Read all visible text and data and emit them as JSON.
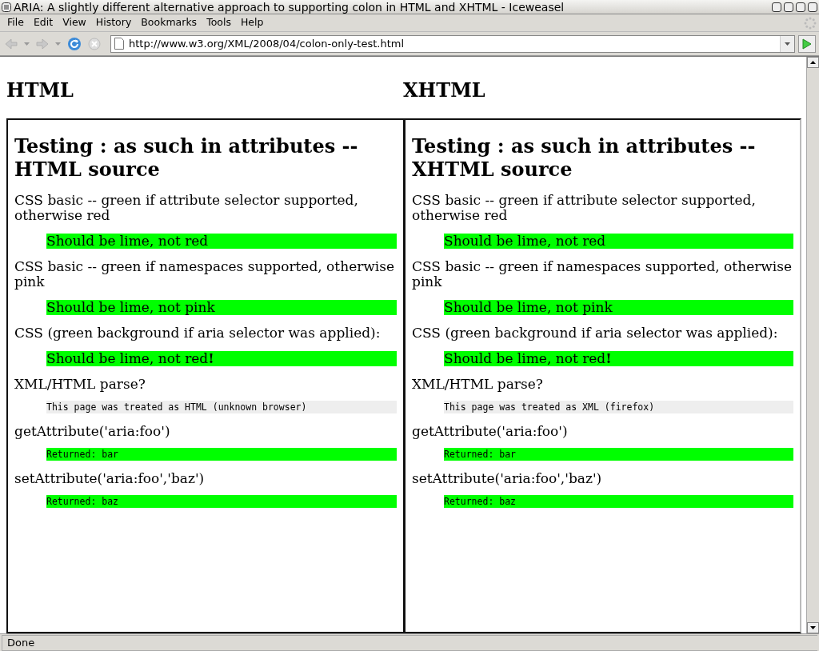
{
  "window": {
    "title": "ARIA: A slightly different alternative approach to supporting colon in HTML and XHTML - Iceweasel"
  },
  "menu": [
    {
      "label": "File"
    },
    {
      "label": "Edit"
    },
    {
      "label": "View"
    },
    {
      "label": "History"
    },
    {
      "label": "Bookmarks"
    },
    {
      "label": "Tools"
    },
    {
      "label": "Help"
    }
  ],
  "toolbar": {
    "back_disabled": true,
    "forward_disabled": true,
    "stop_disabled": true,
    "url": "http://www.w3.org/XML/2008/04/colon-only-test.html"
  },
  "columns": [
    {
      "heading": "HTML",
      "frame": {
        "title": "Testing : as such in attributes -- HTML source",
        "tests": [
          {
            "label": "CSS basic -- green if attribute selector supported, otherwise red",
            "result": {
              "kind": "prose",
              "text": "Should be lime, not red",
              "color": "#00ff00"
            }
          },
          {
            "label": "CSS basic -- green if namespaces supported, otherwise pink",
            "result": {
              "kind": "prose",
              "text": "Should be lime, not pink",
              "color": "#00ff00"
            }
          },
          {
            "label": "CSS (green background if aria selector was applied):",
            "result": {
              "kind": "prose",
              "text": "Should be lime, not red**!**",
              "color": "#00ff00"
            }
          },
          {
            "label": "XML/HTML parse?",
            "result": {
              "kind": "code",
              "text": "This page was treated as HTML (unknown browser)",
              "color": "#eeeeee"
            }
          },
          {
            "label": "getAttribute('aria:foo')",
            "result": {
              "kind": "code",
              "text": "Returned: bar",
              "color": "#00ff00"
            }
          },
          {
            "label": "setAttribute('aria:foo','baz')",
            "result": {
              "kind": "code",
              "text": "Returned: baz",
              "color": "#00ff00"
            }
          }
        ]
      }
    },
    {
      "heading": "XHTML",
      "frame": {
        "title": "Testing : as such in attributes -- XHTML source",
        "tests": [
          {
            "label": "CSS basic -- green if attribute selector supported, otherwise red",
            "result": {
              "kind": "prose",
              "text": "Should be lime, not red",
              "color": "#00ff00"
            }
          },
          {
            "label": "CSS basic -- green if namespaces supported, otherwise pink",
            "result": {
              "kind": "prose",
              "text": "Should be lime, not pink",
              "color": "#00ff00"
            }
          },
          {
            "label": "CSS (green background if aria selector was applied):",
            "result": {
              "kind": "prose",
              "text": "Should be lime, not red**!**",
              "color": "#00ff00"
            }
          },
          {
            "label": "XML/HTML parse?",
            "result": {
              "kind": "code",
              "text": "This page was treated as XML (firefox)",
              "color": "#eeeeee"
            }
          },
          {
            "label": "getAttribute('aria:foo')",
            "result": {
              "kind": "code",
              "text": "Returned: bar",
              "color": "#00ff00"
            }
          },
          {
            "label": "setAttribute('aria:foo','baz')",
            "result": {
              "kind": "code",
              "text": "Returned: baz",
              "color": "#00ff00"
            }
          }
        ]
      }
    }
  ],
  "status_bar": {
    "text": "Done"
  }
}
